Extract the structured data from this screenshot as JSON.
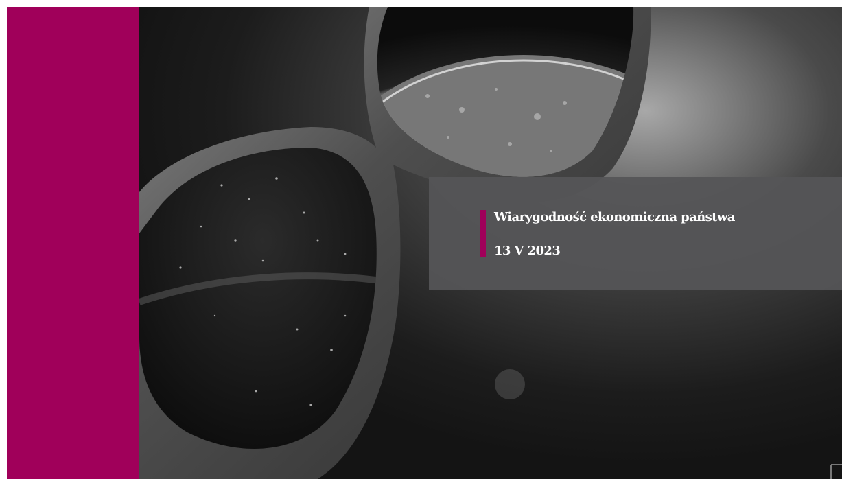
{
  "slide": {
    "title": "Wiarygodność ekonomiczna państwa",
    "date": "13 V 2023"
  },
  "colors": {
    "accent": "#a0005a",
    "title_box": "#555557",
    "text": "#ffffff",
    "background": "#1a1a1a"
  },
  "image": {
    "subject": "sunglasses-reflecting-earth-from-space"
  }
}
